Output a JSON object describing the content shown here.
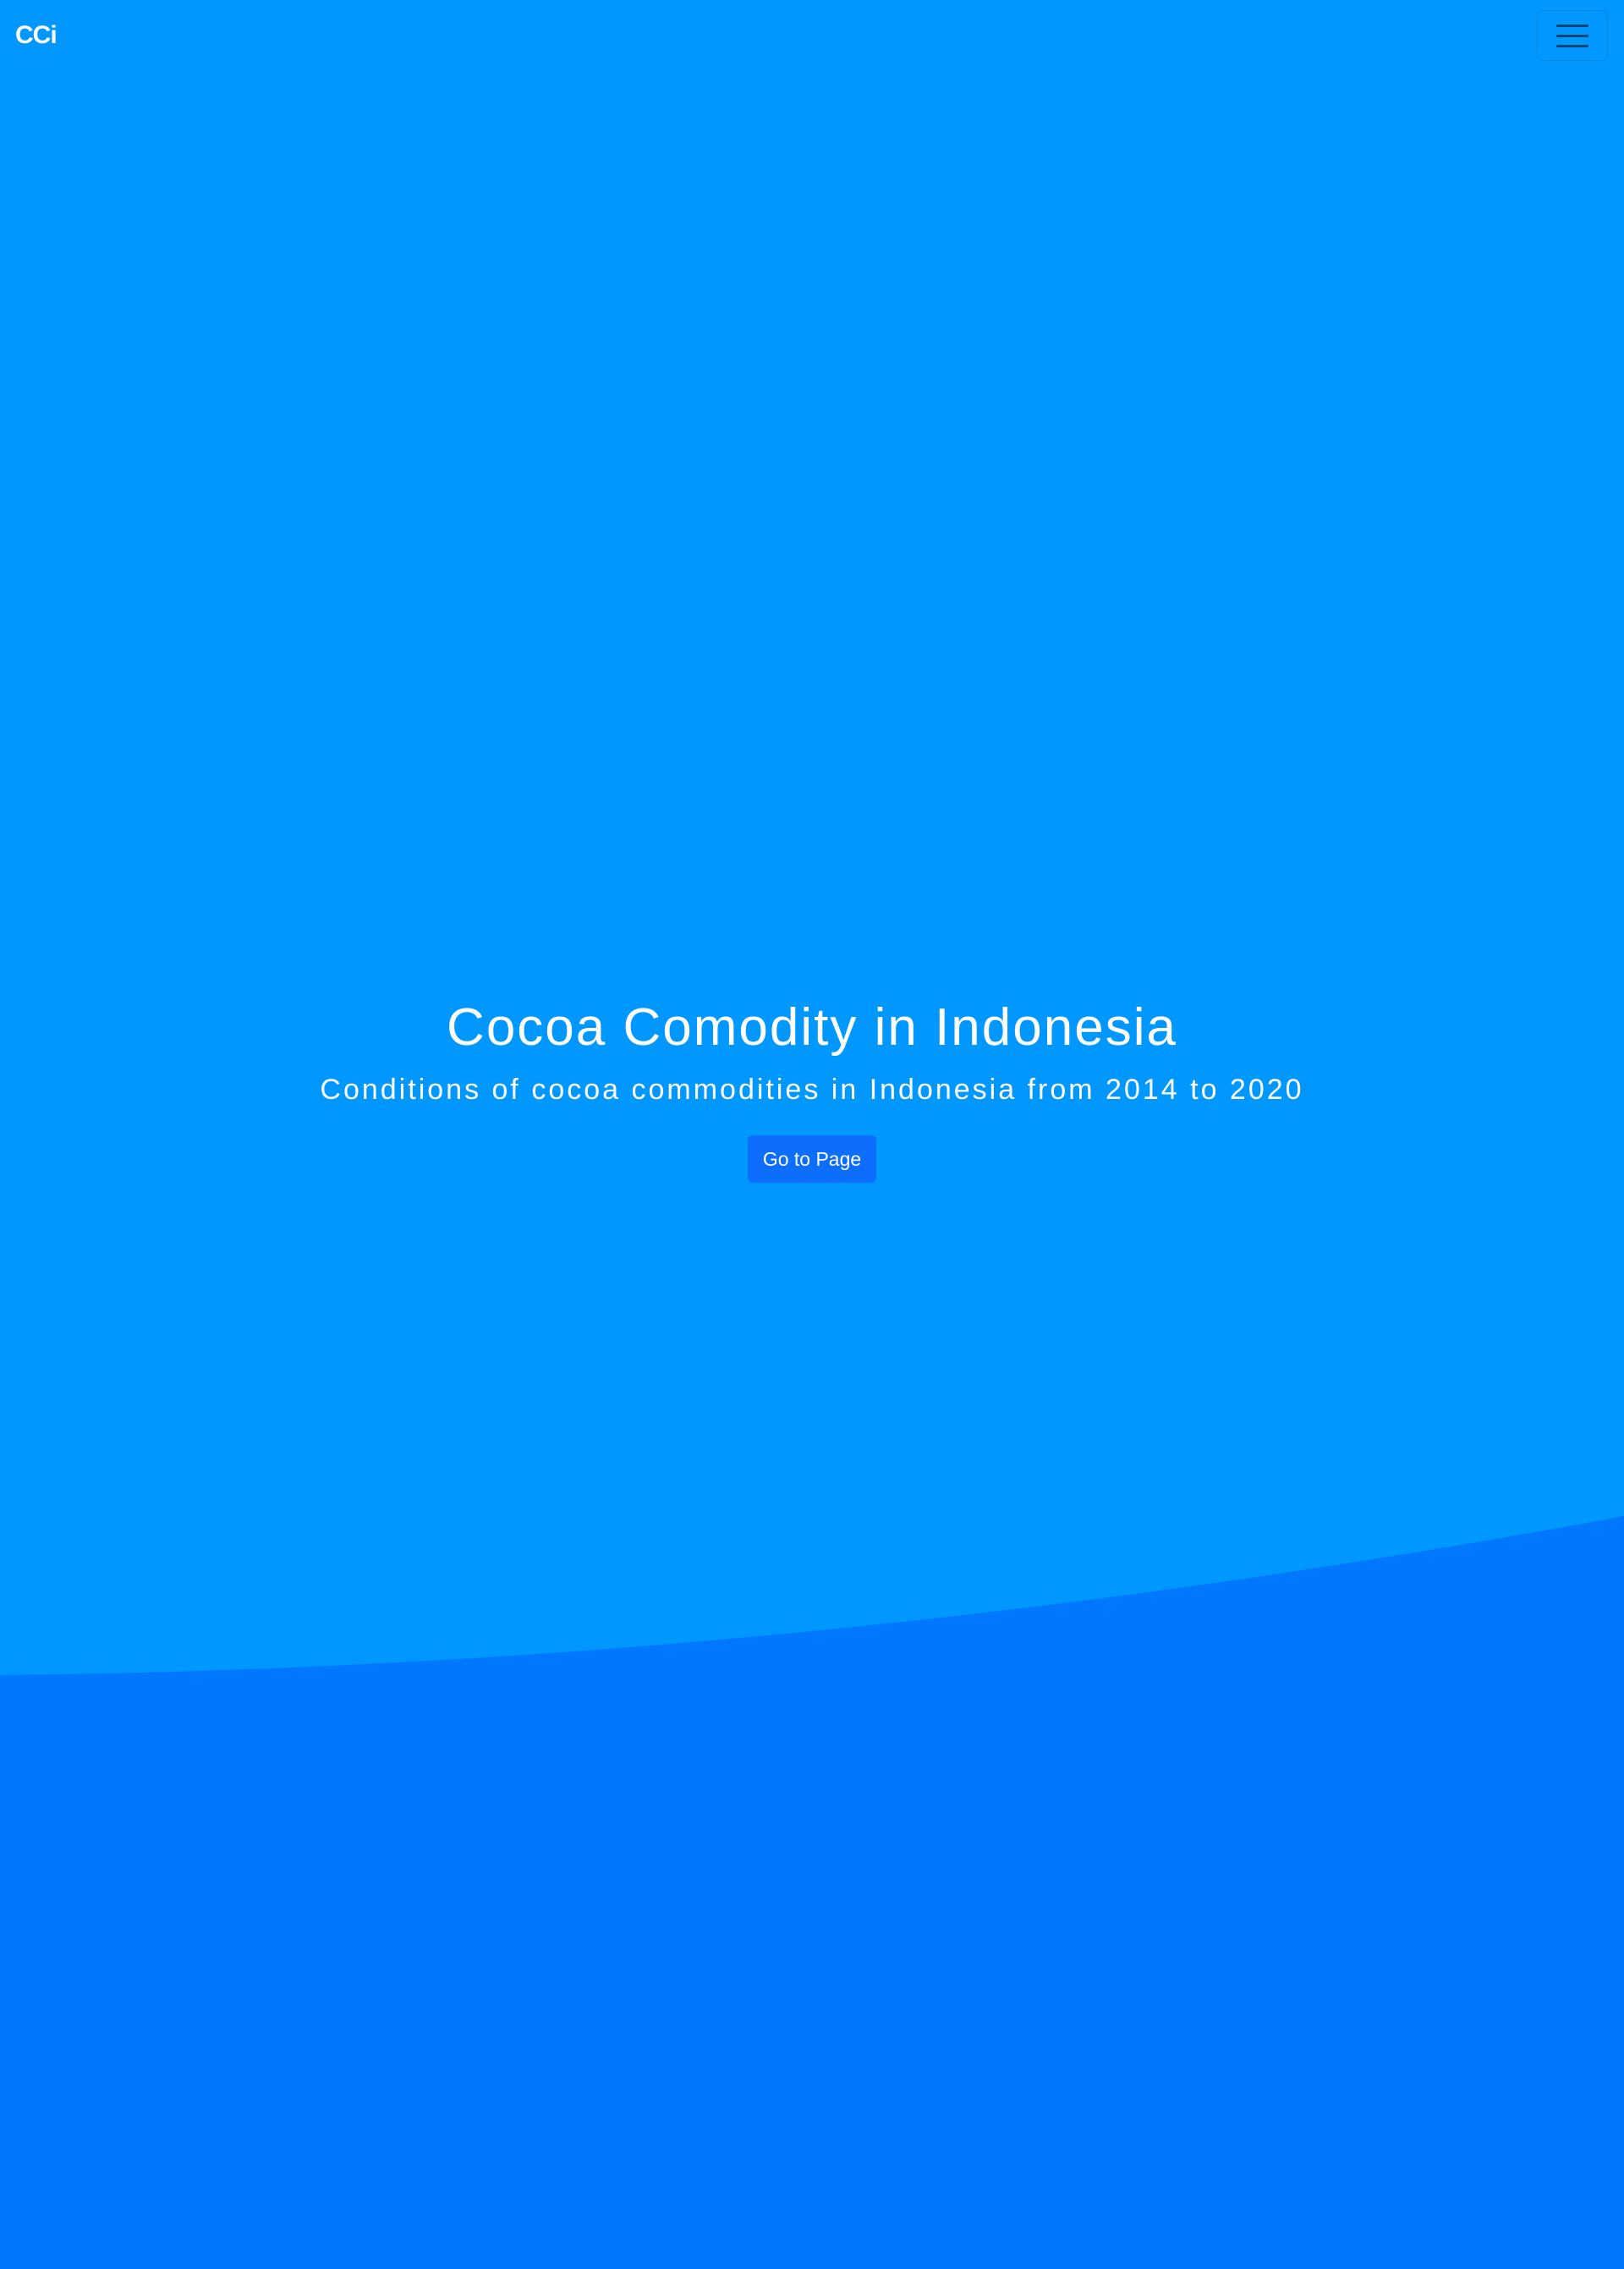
{
  "navbar": {
    "brand": "CCi",
    "menu_icon": "hamburger-menu-icon"
  },
  "hero": {
    "title": "Cocoa Comodity in Indonesia",
    "subtitle": "Conditions of cocoa commodities in Indonesia from 2014 to 2020",
    "button_label": "Go to Page"
  },
  "colors": {
    "hero_background": "#0098ff",
    "lower_background": "#0077ff",
    "button_background": "#0d6efd",
    "text": "#ffffff"
  }
}
